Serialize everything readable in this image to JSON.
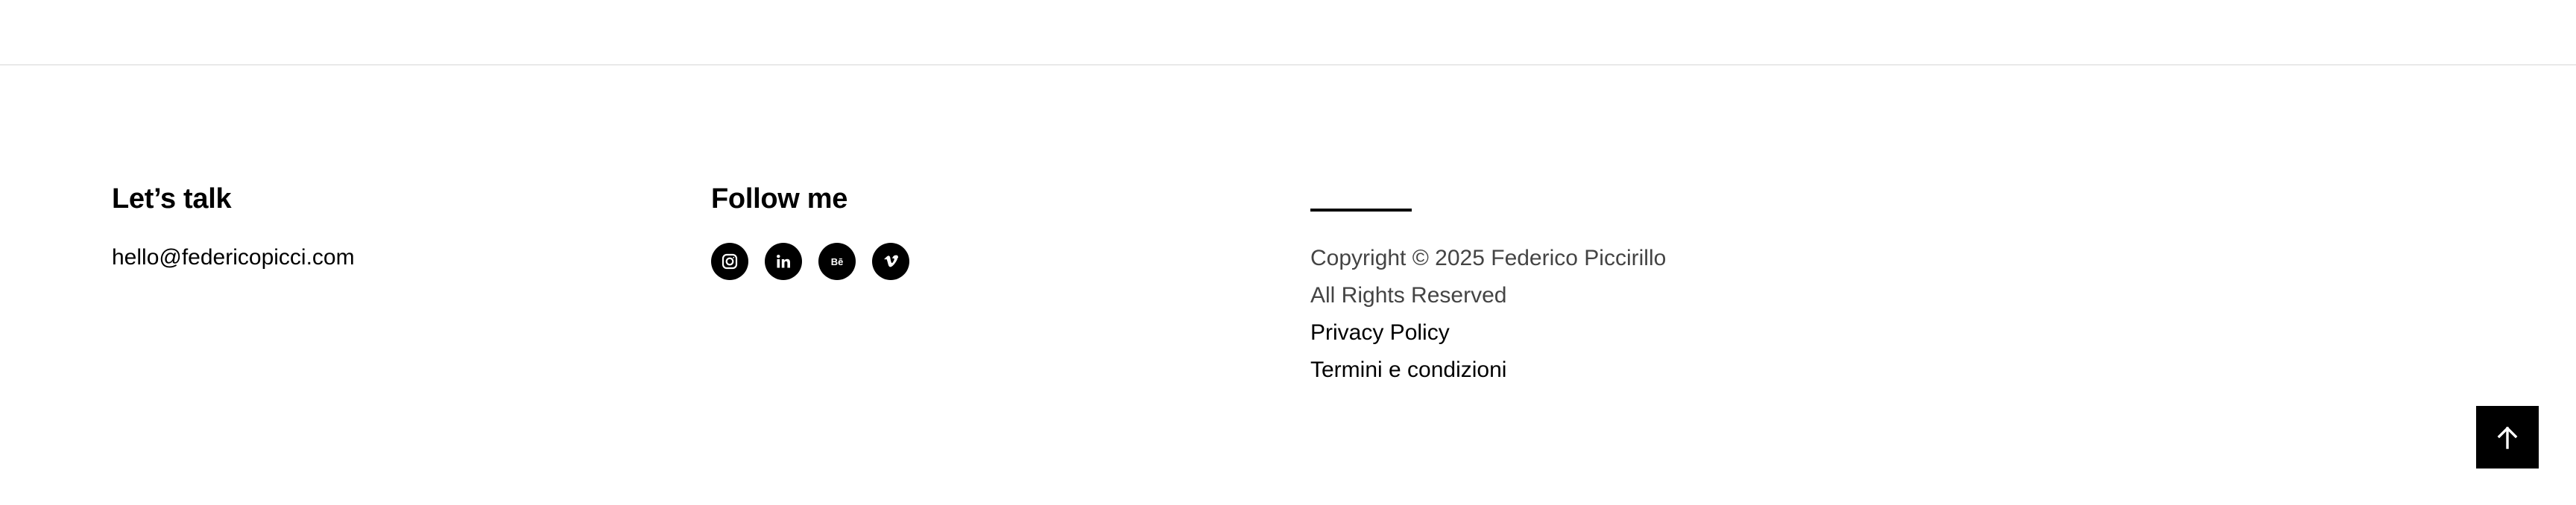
{
  "talk": {
    "heading": "Let’s talk",
    "email": "hello@federicopicci.com"
  },
  "follow": {
    "heading": "Follow me",
    "socials": [
      {
        "icon": "instagram-icon"
      },
      {
        "icon": "linkedin-icon",
        "glyph": "in"
      },
      {
        "icon": "behance-icon",
        "glyph": "Bē"
      },
      {
        "icon": "vimeo-icon",
        "glyph": "v"
      }
    ]
  },
  "legal": {
    "copyright": "Copyright © 2025 Federico Piccirillo",
    "rights": "All Rights Reserved",
    "privacy": "Privacy Policy",
    "terms": "Termini e condizioni"
  },
  "back_to_top": {
    "icon": "arrow-up-icon"
  },
  "colors": {
    "background": "#ffffff",
    "text": "#000000",
    "muted_text": "#444444",
    "divider": "#e9e9e9"
  }
}
